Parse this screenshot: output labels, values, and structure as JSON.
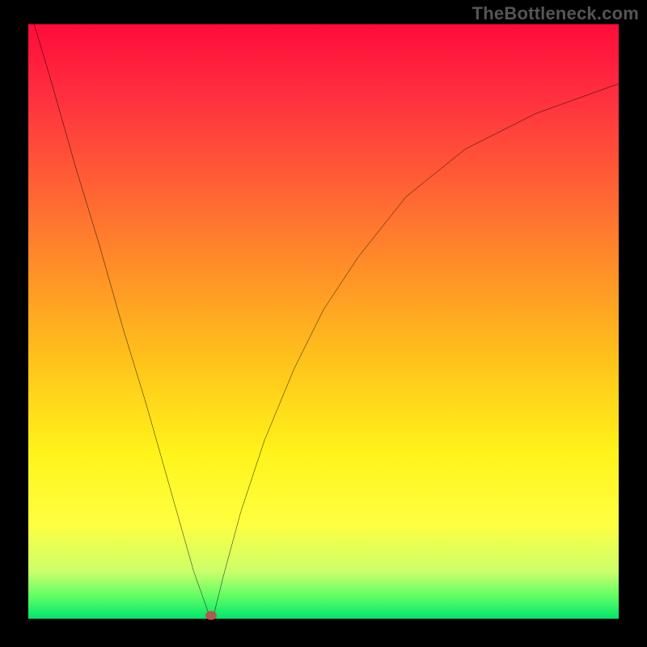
{
  "watermark": "TheBottleneck.com",
  "chart_data": {
    "type": "line",
    "title": "",
    "xlabel": "",
    "ylabel": "",
    "xlim": [
      0,
      100
    ],
    "ylim": [
      0,
      100
    ],
    "grid": false,
    "legend": false,
    "background_gradient": {
      "direction": "top-to-bottom",
      "stops": [
        {
          "pos": 0.0,
          "color": "#ff0b3a"
        },
        {
          "pos": 0.5,
          "color": "#ffc71a"
        },
        {
          "pos": 0.85,
          "color": "#ffff40"
        },
        {
          "pos": 1.0,
          "color": "#00e66a"
        }
      ]
    },
    "series": [
      {
        "name": "bottleneck-curve",
        "color": "#000000",
        "x": [
          1,
          4,
          8,
          12,
          16,
          20,
          24,
          28,
          30.5,
          31.0,
          31.5,
          33,
          36,
          40,
          45,
          50,
          56,
          64,
          74,
          86,
          100
        ],
        "values": [
          100,
          90,
          76,
          63,
          49,
          36,
          22,
          8,
          1,
          0.5,
          1,
          7,
          18,
          30,
          42,
          52,
          61,
          71,
          79,
          85,
          90
        ]
      }
    ],
    "marker": {
      "x": 31.0,
      "y": 0.5,
      "color": "#b25850"
    }
  }
}
